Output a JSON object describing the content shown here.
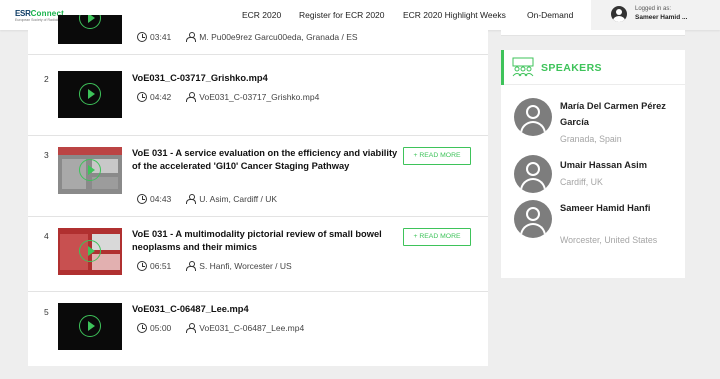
{
  "header": {
    "logo_text": "ESR Connect",
    "logo_sub": "European Society of Radiology",
    "nav": [
      "ECR 2020",
      "Register for ECR 2020",
      "ECR 2020 Highlight Weeks",
      "On-Demand"
    ],
    "login_label": "Logged in as:",
    "login_user": "Sameer Hamid ..."
  },
  "videos": [
    {
      "num": "",
      "title": "",
      "duration": "03:41",
      "speaker": "M. Pu00e9rez Garcu00eda, Granada / ES",
      "has_readmore": false
    },
    {
      "num": "2",
      "title": "VoE031_C-03717_Grishko.mp4",
      "duration": "04:42",
      "speaker": "VoE031_C-03717_Grishko.mp4",
      "has_readmore": false
    },
    {
      "num": "3",
      "title": "VoE 031 - A service evaluation on the efficiency and viability of the accelerated 'GI10' Cancer Staging Pathway",
      "duration": "04:43",
      "speaker": "U. Asim, Cardiff / UK",
      "has_readmore": true
    },
    {
      "num": "4",
      "title": "VoE 031 - A multimodality pictorial review of small bowel neoplasms and their mimics",
      "duration": "06:51",
      "speaker": "S. Hanfi, Worcester / US",
      "has_readmore": true
    },
    {
      "num": "5",
      "title": "VoE031_C-06487_Lee.mp4",
      "duration": "05:00",
      "speaker": "VoE031_C-06487_Lee.mp4",
      "has_readmore": false
    }
  ],
  "readmore_label": "+ READ MORE",
  "speakers": {
    "title": "SPEAKERS",
    "items": [
      {
        "name": "María Del Carmen Pérez García",
        "location": "Granada, Spain"
      },
      {
        "name": "Umair Hassan Asim",
        "location": "Cardiff, UK"
      },
      {
        "name": "Sameer Hamid Hanfi",
        "location": "Worcester, United States"
      }
    ]
  },
  "colors": {
    "accent": "#3ec35a",
    "brand": "#0f3d66",
    "background": "#eeeeee"
  },
  "icons": [
    "play-icon",
    "clock-icon",
    "person-icon",
    "user-avatar-icon",
    "speakers-icon"
  ]
}
